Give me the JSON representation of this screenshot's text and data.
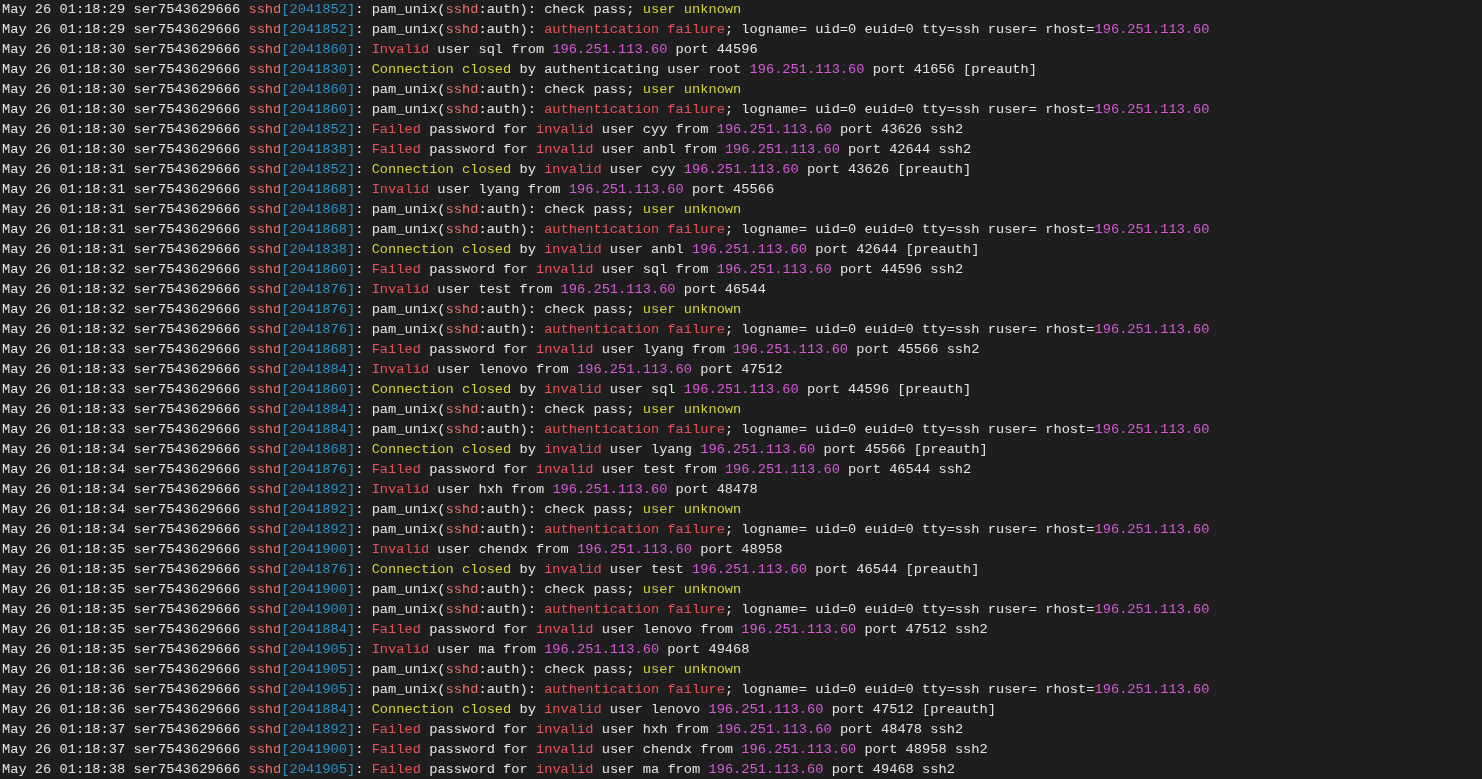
{
  "terminal": {
    "lines": [
      {
        "segments": [
          {
            "kind": "plain",
            "text": "May 26 01:18:29 ser7543629666 "
          },
          {
            "kind": "process",
            "text": "sshd"
          },
          {
            "kind": "pid",
            "text": "[2041852]"
          },
          {
            "kind": "plain",
            "text": ": pam_unix("
          },
          {
            "kind": "process",
            "text": "sshd"
          },
          {
            "kind": "plain",
            "text": ":auth): check pass; "
          },
          {
            "kind": "warning",
            "text": "user unknown"
          }
        ]
      },
      {
        "segments": [
          {
            "kind": "plain",
            "text": "May 26 01:18:29 ser7543629666 "
          },
          {
            "kind": "process",
            "text": "sshd"
          },
          {
            "kind": "pid",
            "text": "[2041852]"
          },
          {
            "kind": "plain",
            "text": ": pam_unix("
          },
          {
            "kind": "process",
            "text": "sshd"
          },
          {
            "kind": "plain",
            "text": ":auth): "
          },
          {
            "kind": "error",
            "text": "authentication failure"
          },
          {
            "kind": "plain",
            "text": "; logname= uid=0 euid=0 tty=ssh ruser= rhost="
          },
          {
            "kind": "address",
            "text": "196.251.113.60"
          }
        ]
      },
      {
        "segments": [
          {
            "kind": "plain",
            "text": "May 26 01:18:30 ser7543629666 "
          },
          {
            "kind": "process",
            "text": "sshd"
          },
          {
            "kind": "pid",
            "text": "[2041860]"
          },
          {
            "kind": "plain",
            "text": ": "
          },
          {
            "kind": "error",
            "text": "Invalid"
          },
          {
            "kind": "plain",
            "text": " user sql from "
          },
          {
            "kind": "address",
            "text": "196.251.113.60"
          },
          {
            "kind": "plain",
            "text": " port 44596"
          }
        ]
      },
      {
        "segments": [
          {
            "kind": "plain",
            "text": "May 26 01:18:30 ser7543629666 "
          },
          {
            "kind": "process",
            "text": "sshd"
          },
          {
            "kind": "pid",
            "text": "[2041830]"
          },
          {
            "kind": "plain",
            "text": ": "
          },
          {
            "kind": "warning",
            "text": "Connection closed"
          },
          {
            "kind": "plain",
            "text": " by authenticating user root "
          },
          {
            "kind": "address",
            "text": "196.251.113.60"
          },
          {
            "kind": "plain",
            "text": " port 41656 [preauth]"
          }
        ]
      },
      {
        "segments": [
          {
            "kind": "plain",
            "text": "May 26 01:18:30 ser7543629666 "
          },
          {
            "kind": "process",
            "text": "sshd"
          },
          {
            "kind": "pid",
            "text": "[2041860]"
          },
          {
            "kind": "plain",
            "text": ": pam_unix("
          },
          {
            "kind": "process",
            "text": "sshd"
          },
          {
            "kind": "plain",
            "text": ":auth): check pass; "
          },
          {
            "kind": "warning",
            "text": "user unknown"
          }
        ]
      },
      {
        "segments": [
          {
            "kind": "plain",
            "text": "May 26 01:18:30 ser7543629666 "
          },
          {
            "kind": "process",
            "text": "sshd"
          },
          {
            "kind": "pid",
            "text": "[2041860]"
          },
          {
            "kind": "plain",
            "text": ": pam_unix("
          },
          {
            "kind": "process",
            "text": "sshd"
          },
          {
            "kind": "plain",
            "text": ":auth): "
          },
          {
            "kind": "error",
            "text": "authentication failure"
          },
          {
            "kind": "plain",
            "text": "; logname= uid=0 euid=0 tty=ssh ruser= rhost="
          },
          {
            "kind": "address",
            "text": "196.251.113.60"
          }
        ]
      },
      {
        "segments": [
          {
            "kind": "plain",
            "text": "May 26 01:18:30 ser7543629666 "
          },
          {
            "kind": "process",
            "text": "sshd"
          },
          {
            "kind": "pid",
            "text": "[2041852]"
          },
          {
            "kind": "plain",
            "text": ": "
          },
          {
            "kind": "error",
            "text": "Failed"
          },
          {
            "kind": "plain",
            "text": " password for "
          },
          {
            "kind": "error",
            "text": "invalid"
          },
          {
            "kind": "plain",
            "text": " user cyy from "
          },
          {
            "kind": "address",
            "text": "196.251.113.60"
          },
          {
            "kind": "plain",
            "text": " port 43626 ssh2"
          }
        ]
      },
      {
        "segments": [
          {
            "kind": "plain",
            "text": "May 26 01:18:30 ser7543629666 "
          },
          {
            "kind": "process",
            "text": "sshd"
          },
          {
            "kind": "pid",
            "text": "[2041838]"
          },
          {
            "kind": "plain",
            "text": ": "
          },
          {
            "kind": "error",
            "text": "Failed"
          },
          {
            "kind": "plain",
            "text": " password for "
          },
          {
            "kind": "error",
            "text": "invalid"
          },
          {
            "kind": "plain",
            "text": " user anbl from "
          },
          {
            "kind": "address",
            "text": "196.251.113.60"
          },
          {
            "kind": "plain",
            "text": " port 42644 ssh2"
          }
        ]
      },
      {
        "segments": [
          {
            "kind": "plain",
            "text": "May 26 01:18:31 ser7543629666 "
          },
          {
            "kind": "process",
            "text": "sshd"
          },
          {
            "kind": "pid",
            "text": "[2041852]"
          },
          {
            "kind": "plain",
            "text": ": "
          },
          {
            "kind": "warning",
            "text": "Connection closed"
          },
          {
            "kind": "plain",
            "text": " by "
          },
          {
            "kind": "error",
            "text": "invalid"
          },
          {
            "kind": "plain",
            "text": " user cyy "
          },
          {
            "kind": "address",
            "text": "196.251.113.60"
          },
          {
            "kind": "plain",
            "text": " port 43626 [preauth]"
          }
        ]
      },
      {
        "segments": [
          {
            "kind": "plain",
            "text": "May 26 01:18:31 ser7543629666 "
          },
          {
            "kind": "process",
            "text": "sshd"
          },
          {
            "kind": "pid",
            "text": "[2041868]"
          },
          {
            "kind": "plain",
            "text": ": "
          },
          {
            "kind": "error",
            "text": "Invalid"
          },
          {
            "kind": "plain",
            "text": " user lyang from "
          },
          {
            "kind": "address",
            "text": "196.251.113.60"
          },
          {
            "kind": "plain",
            "text": " port 45566"
          }
        ]
      },
      {
        "segments": [
          {
            "kind": "plain",
            "text": "May 26 01:18:31 ser7543629666 "
          },
          {
            "kind": "process",
            "text": "sshd"
          },
          {
            "kind": "pid",
            "text": "[2041868]"
          },
          {
            "kind": "plain",
            "text": ": pam_unix("
          },
          {
            "kind": "process",
            "text": "sshd"
          },
          {
            "kind": "plain",
            "text": ":auth): check pass; "
          },
          {
            "kind": "warning",
            "text": "user unknown"
          }
        ]
      },
      {
        "segments": [
          {
            "kind": "plain",
            "text": "May 26 01:18:31 ser7543629666 "
          },
          {
            "kind": "process",
            "text": "sshd"
          },
          {
            "kind": "pid",
            "text": "[2041868]"
          },
          {
            "kind": "plain",
            "text": ": pam_unix("
          },
          {
            "kind": "process",
            "text": "sshd"
          },
          {
            "kind": "plain",
            "text": ":auth): "
          },
          {
            "kind": "error",
            "text": "authentication failure"
          },
          {
            "kind": "plain",
            "text": "; logname= uid=0 euid=0 tty=ssh ruser= rhost="
          },
          {
            "kind": "address",
            "text": "196.251.113.60"
          }
        ]
      },
      {
        "segments": [
          {
            "kind": "plain",
            "text": "May 26 01:18:31 ser7543629666 "
          },
          {
            "kind": "process",
            "text": "sshd"
          },
          {
            "kind": "pid",
            "text": "[2041838]"
          },
          {
            "kind": "plain",
            "text": ": "
          },
          {
            "kind": "warning",
            "text": "Connection closed"
          },
          {
            "kind": "plain",
            "text": " by "
          },
          {
            "kind": "error",
            "text": "invalid"
          },
          {
            "kind": "plain",
            "text": " user anbl "
          },
          {
            "kind": "address",
            "text": "196.251.113.60"
          },
          {
            "kind": "plain",
            "text": " port 42644 [preauth]"
          }
        ]
      },
      {
        "segments": [
          {
            "kind": "plain",
            "text": "May 26 01:18:32 ser7543629666 "
          },
          {
            "kind": "process",
            "text": "sshd"
          },
          {
            "kind": "pid",
            "text": "[2041860]"
          },
          {
            "kind": "plain",
            "text": ": "
          },
          {
            "kind": "error",
            "text": "Failed"
          },
          {
            "kind": "plain",
            "text": " password for "
          },
          {
            "kind": "error",
            "text": "invalid"
          },
          {
            "kind": "plain",
            "text": " user sql from "
          },
          {
            "kind": "address",
            "text": "196.251.113.60"
          },
          {
            "kind": "plain",
            "text": " port 44596 ssh2"
          }
        ]
      },
      {
        "segments": [
          {
            "kind": "plain",
            "text": "May 26 01:18:32 ser7543629666 "
          },
          {
            "kind": "process",
            "text": "sshd"
          },
          {
            "kind": "pid",
            "text": "[2041876]"
          },
          {
            "kind": "plain",
            "text": ": "
          },
          {
            "kind": "error",
            "text": "Invalid"
          },
          {
            "kind": "plain",
            "text": " user test from "
          },
          {
            "kind": "address",
            "text": "196.251.113.60"
          },
          {
            "kind": "plain",
            "text": " port 46544"
          }
        ]
      },
      {
        "segments": [
          {
            "kind": "plain",
            "text": "May 26 01:18:32 ser7543629666 "
          },
          {
            "kind": "process",
            "text": "sshd"
          },
          {
            "kind": "pid",
            "text": "[2041876]"
          },
          {
            "kind": "plain",
            "text": ": pam_unix("
          },
          {
            "kind": "process",
            "text": "sshd"
          },
          {
            "kind": "plain",
            "text": ":auth): check pass; "
          },
          {
            "kind": "warning",
            "text": "user unknown"
          }
        ]
      },
      {
        "segments": [
          {
            "kind": "plain",
            "text": "May 26 01:18:32 ser7543629666 "
          },
          {
            "kind": "process",
            "text": "sshd"
          },
          {
            "kind": "pid",
            "text": "[2041876]"
          },
          {
            "kind": "plain",
            "text": ": pam_unix("
          },
          {
            "kind": "process",
            "text": "sshd"
          },
          {
            "kind": "plain",
            "text": ":auth): "
          },
          {
            "kind": "error",
            "text": "authentication failure"
          },
          {
            "kind": "plain",
            "text": "; logname= uid=0 euid=0 tty=ssh ruser= rhost="
          },
          {
            "kind": "address",
            "text": "196.251.113.60"
          }
        ]
      },
      {
        "segments": [
          {
            "kind": "plain",
            "text": "May 26 01:18:33 ser7543629666 "
          },
          {
            "kind": "process",
            "text": "sshd"
          },
          {
            "kind": "pid",
            "text": "[2041868]"
          },
          {
            "kind": "plain",
            "text": ": "
          },
          {
            "kind": "error",
            "text": "Failed"
          },
          {
            "kind": "plain",
            "text": " password for "
          },
          {
            "kind": "error",
            "text": "invalid"
          },
          {
            "kind": "plain",
            "text": " user lyang from "
          },
          {
            "kind": "address",
            "text": "196.251.113.60"
          },
          {
            "kind": "plain",
            "text": " port 45566 ssh2"
          }
        ]
      },
      {
        "segments": [
          {
            "kind": "plain",
            "text": "May 26 01:18:33 ser7543629666 "
          },
          {
            "kind": "process",
            "text": "sshd"
          },
          {
            "kind": "pid",
            "text": "[2041884]"
          },
          {
            "kind": "plain",
            "text": ": "
          },
          {
            "kind": "error",
            "text": "Invalid"
          },
          {
            "kind": "plain",
            "text": " user lenovo from "
          },
          {
            "kind": "address",
            "text": "196.251.113.60"
          },
          {
            "kind": "plain",
            "text": " port 47512"
          }
        ]
      },
      {
        "segments": [
          {
            "kind": "plain",
            "text": "May 26 01:18:33 ser7543629666 "
          },
          {
            "kind": "process",
            "text": "sshd"
          },
          {
            "kind": "pid",
            "text": "[2041860]"
          },
          {
            "kind": "plain",
            "text": ": "
          },
          {
            "kind": "warning",
            "text": "Connection closed"
          },
          {
            "kind": "plain",
            "text": " by "
          },
          {
            "kind": "error",
            "text": "invalid"
          },
          {
            "kind": "plain",
            "text": " user sql "
          },
          {
            "kind": "address",
            "text": "196.251.113.60"
          },
          {
            "kind": "plain",
            "text": " port 44596 [preauth]"
          }
        ]
      },
      {
        "segments": [
          {
            "kind": "plain",
            "text": "May 26 01:18:33 ser7543629666 "
          },
          {
            "kind": "process",
            "text": "sshd"
          },
          {
            "kind": "pid",
            "text": "[2041884]"
          },
          {
            "kind": "plain",
            "text": ": pam_unix("
          },
          {
            "kind": "process",
            "text": "sshd"
          },
          {
            "kind": "plain",
            "text": ":auth): check pass; "
          },
          {
            "kind": "warning",
            "text": "user unknown"
          }
        ]
      },
      {
        "segments": [
          {
            "kind": "plain",
            "text": "May 26 01:18:33 ser7543629666 "
          },
          {
            "kind": "process",
            "text": "sshd"
          },
          {
            "kind": "pid",
            "text": "[2041884]"
          },
          {
            "kind": "plain",
            "text": ": pam_unix("
          },
          {
            "kind": "process",
            "text": "sshd"
          },
          {
            "kind": "plain",
            "text": ":auth): "
          },
          {
            "kind": "error",
            "text": "authentication failure"
          },
          {
            "kind": "plain",
            "text": "; logname= uid=0 euid=0 tty=ssh ruser= rhost="
          },
          {
            "kind": "address",
            "text": "196.251.113.60"
          }
        ]
      },
      {
        "segments": [
          {
            "kind": "plain",
            "text": "May 26 01:18:34 ser7543629666 "
          },
          {
            "kind": "process",
            "text": "sshd"
          },
          {
            "kind": "pid",
            "text": "[2041868]"
          },
          {
            "kind": "plain",
            "text": ": "
          },
          {
            "kind": "warning",
            "text": "Connection closed"
          },
          {
            "kind": "plain",
            "text": " by "
          },
          {
            "kind": "error",
            "text": "invalid"
          },
          {
            "kind": "plain",
            "text": " user lyang "
          },
          {
            "kind": "address",
            "text": "196.251.113.60"
          },
          {
            "kind": "plain",
            "text": " port 45566 [preauth]"
          }
        ]
      },
      {
        "segments": [
          {
            "kind": "plain",
            "text": "May 26 01:18:34 ser7543629666 "
          },
          {
            "kind": "process",
            "text": "sshd"
          },
          {
            "kind": "pid",
            "text": "[2041876]"
          },
          {
            "kind": "plain",
            "text": ": "
          },
          {
            "kind": "error",
            "text": "Failed"
          },
          {
            "kind": "plain",
            "text": " password for "
          },
          {
            "kind": "error",
            "text": "invalid"
          },
          {
            "kind": "plain",
            "text": " user test from "
          },
          {
            "kind": "address",
            "text": "196.251.113.60"
          },
          {
            "kind": "plain",
            "text": " port 46544 ssh2"
          }
        ]
      },
      {
        "segments": [
          {
            "kind": "plain",
            "text": "May 26 01:18:34 ser7543629666 "
          },
          {
            "kind": "process",
            "text": "sshd"
          },
          {
            "kind": "pid",
            "text": "[2041892]"
          },
          {
            "kind": "plain",
            "text": ": "
          },
          {
            "kind": "error",
            "text": "Invalid"
          },
          {
            "kind": "plain",
            "text": " user hxh from "
          },
          {
            "kind": "address",
            "text": "196.251.113.60"
          },
          {
            "kind": "plain",
            "text": " port 48478"
          }
        ]
      },
      {
        "segments": [
          {
            "kind": "plain",
            "text": "May 26 01:18:34 ser7543629666 "
          },
          {
            "kind": "process",
            "text": "sshd"
          },
          {
            "kind": "pid",
            "text": "[2041892]"
          },
          {
            "kind": "plain",
            "text": ": pam_unix("
          },
          {
            "kind": "process",
            "text": "sshd"
          },
          {
            "kind": "plain",
            "text": ":auth): check pass; "
          },
          {
            "kind": "warning",
            "text": "user unknown"
          }
        ]
      },
      {
        "segments": [
          {
            "kind": "plain",
            "text": "May 26 01:18:34 ser7543629666 "
          },
          {
            "kind": "process",
            "text": "sshd"
          },
          {
            "kind": "pid",
            "text": "[2041892]"
          },
          {
            "kind": "plain",
            "text": ": pam_unix("
          },
          {
            "kind": "process",
            "text": "sshd"
          },
          {
            "kind": "plain",
            "text": ":auth): "
          },
          {
            "kind": "error",
            "text": "authentication failure"
          },
          {
            "kind": "plain",
            "text": "; logname= uid=0 euid=0 tty=ssh ruser= rhost="
          },
          {
            "kind": "address",
            "text": "196.251.113.60"
          }
        ]
      },
      {
        "segments": [
          {
            "kind": "plain",
            "text": "May 26 01:18:35 ser7543629666 "
          },
          {
            "kind": "process",
            "text": "sshd"
          },
          {
            "kind": "pid",
            "text": "[2041900]"
          },
          {
            "kind": "plain",
            "text": ": "
          },
          {
            "kind": "error",
            "text": "Invalid"
          },
          {
            "kind": "plain",
            "text": " user chendx from "
          },
          {
            "kind": "address",
            "text": "196.251.113.60"
          },
          {
            "kind": "plain",
            "text": " port 48958"
          }
        ]
      },
      {
        "segments": [
          {
            "kind": "plain",
            "text": "May 26 01:18:35 ser7543629666 "
          },
          {
            "kind": "process",
            "text": "sshd"
          },
          {
            "kind": "pid",
            "text": "[2041876]"
          },
          {
            "kind": "plain",
            "text": ": "
          },
          {
            "kind": "warning",
            "text": "Connection closed"
          },
          {
            "kind": "plain",
            "text": " by "
          },
          {
            "kind": "error",
            "text": "invalid"
          },
          {
            "kind": "plain",
            "text": " user test "
          },
          {
            "kind": "address",
            "text": "196.251.113.60"
          },
          {
            "kind": "plain",
            "text": " port 46544 [preauth]"
          }
        ]
      },
      {
        "segments": [
          {
            "kind": "plain",
            "text": "May 26 01:18:35 ser7543629666 "
          },
          {
            "kind": "process",
            "text": "sshd"
          },
          {
            "kind": "pid",
            "text": "[2041900]"
          },
          {
            "kind": "plain",
            "text": ": pam_unix("
          },
          {
            "kind": "process",
            "text": "sshd"
          },
          {
            "kind": "plain",
            "text": ":auth): check pass; "
          },
          {
            "kind": "warning",
            "text": "user unknown"
          }
        ]
      },
      {
        "segments": [
          {
            "kind": "plain",
            "text": "May 26 01:18:35 ser7543629666 "
          },
          {
            "kind": "process",
            "text": "sshd"
          },
          {
            "kind": "pid",
            "text": "[2041900]"
          },
          {
            "kind": "plain",
            "text": ": pam_unix("
          },
          {
            "kind": "process",
            "text": "sshd"
          },
          {
            "kind": "plain",
            "text": ":auth): "
          },
          {
            "kind": "error",
            "text": "authentication failure"
          },
          {
            "kind": "plain",
            "text": "; logname= uid=0 euid=0 tty=ssh ruser= rhost="
          },
          {
            "kind": "address",
            "text": "196.251.113.60"
          }
        ]
      },
      {
        "segments": [
          {
            "kind": "plain",
            "text": "May 26 01:18:35 ser7543629666 "
          },
          {
            "kind": "process",
            "text": "sshd"
          },
          {
            "kind": "pid",
            "text": "[2041884]"
          },
          {
            "kind": "plain",
            "text": ": "
          },
          {
            "kind": "error",
            "text": "Failed"
          },
          {
            "kind": "plain",
            "text": " password for "
          },
          {
            "kind": "error",
            "text": "invalid"
          },
          {
            "kind": "plain",
            "text": " user lenovo from "
          },
          {
            "kind": "address",
            "text": "196.251.113.60"
          },
          {
            "kind": "plain",
            "text": " port 47512 ssh2"
          }
        ]
      },
      {
        "segments": [
          {
            "kind": "plain",
            "text": "May 26 01:18:35 ser7543629666 "
          },
          {
            "kind": "process",
            "text": "sshd"
          },
          {
            "kind": "pid",
            "text": "[2041905]"
          },
          {
            "kind": "plain",
            "text": ": "
          },
          {
            "kind": "error",
            "text": "Invalid"
          },
          {
            "kind": "plain",
            "text": " user ma from "
          },
          {
            "kind": "address",
            "text": "196.251.113.60"
          },
          {
            "kind": "plain",
            "text": " port 49468"
          }
        ]
      },
      {
        "segments": [
          {
            "kind": "plain",
            "text": "May 26 01:18:36 ser7543629666 "
          },
          {
            "kind": "process",
            "text": "sshd"
          },
          {
            "kind": "pid",
            "text": "[2041905]"
          },
          {
            "kind": "plain",
            "text": ": pam_unix("
          },
          {
            "kind": "process",
            "text": "sshd"
          },
          {
            "kind": "plain",
            "text": ":auth): check pass; "
          },
          {
            "kind": "warning",
            "text": "user unknown"
          }
        ]
      },
      {
        "segments": [
          {
            "kind": "plain",
            "text": "May 26 01:18:36 ser7543629666 "
          },
          {
            "kind": "process",
            "text": "sshd"
          },
          {
            "kind": "pid",
            "text": "[2041905]"
          },
          {
            "kind": "plain",
            "text": ": pam_unix("
          },
          {
            "kind": "process",
            "text": "sshd"
          },
          {
            "kind": "plain",
            "text": ":auth): "
          },
          {
            "kind": "error",
            "text": "authentication failure"
          },
          {
            "kind": "plain",
            "text": "; logname= uid=0 euid=0 tty=ssh ruser= rhost="
          },
          {
            "kind": "address",
            "text": "196.251.113.60"
          }
        ]
      },
      {
        "segments": [
          {
            "kind": "plain",
            "text": "May 26 01:18:36 ser7543629666 "
          },
          {
            "kind": "process",
            "text": "sshd"
          },
          {
            "kind": "pid",
            "text": "[2041884]"
          },
          {
            "kind": "plain",
            "text": ": "
          },
          {
            "kind": "warning",
            "text": "Connection closed"
          },
          {
            "kind": "plain",
            "text": " by "
          },
          {
            "kind": "error",
            "text": "invalid"
          },
          {
            "kind": "plain",
            "text": " user lenovo "
          },
          {
            "kind": "address",
            "text": "196.251.113.60"
          },
          {
            "kind": "plain",
            "text": " port 47512 [preauth]"
          }
        ]
      },
      {
        "segments": [
          {
            "kind": "plain",
            "text": "May 26 01:18:37 ser7543629666 "
          },
          {
            "kind": "process",
            "text": "sshd"
          },
          {
            "kind": "pid",
            "text": "[2041892]"
          },
          {
            "kind": "plain",
            "text": ": "
          },
          {
            "kind": "error",
            "text": "Failed"
          },
          {
            "kind": "plain",
            "text": " password for "
          },
          {
            "kind": "error",
            "text": "invalid"
          },
          {
            "kind": "plain",
            "text": " user hxh from "
          },
          {
            "kind": "address",
            "text": "196.251.113.60"
          },
          {
            "kind": "plain",
            "text": " port 48478 ssh2"
          }
        ]
      },
      {
        "segments": [
          {
            "kind": "plain",
            "text": "May 26 01:18:37 ser7543629666 "
          },
          {
            "kind": "process",
            "text": "sshd"
          },
          {
            "kind": "pid",
            "text": "[2041900]"
          },
          {
            "kind": "plain",
            "text": ": "
          },
          {
            "kind": "error",
            "text": "Failed"
          },
          {
            "kind": "plain",
            "text": " password for "
          },
          {
            "kind": "error",
            "text": "invalid"
          },
          {
            "kind": "plain",
            "text": " user chendx from "
          },
          {
            "kind": "address",
            "text": "196.251.113.60"
          },
          {
            "kind": "plain",
            "text": " port 48958 ssh2"
          }
        ]
      },
      {
        "segments": [
          {
            "kind": "plain",
            "text": "May 26 01:18:38 ser7543629666 "
          },
          {
            "kind": "process",
            "text": "sshd"
          },
          {
            "kind": "pid",
            "text": "[2041905]"
          },
          {
            "kind": "plain",
            "text": ": "
          },
          {
            "kind": "error",
            "text": "Failed"
          },
          {
            "kind": "plain",
            "text": " password for "
          },
          {
            "kind": "error",
            "text": "invalid"
          },
          {
            "kind": "plain",
            "text": " user ma from "
          },
          {
            "kind": "address",
            "text": "196.251.113.60"
          },
          {
            "kind": "plain",
            "text": " port 49468 ssh2"
          }
        ]
      }
    ]
  }
}
